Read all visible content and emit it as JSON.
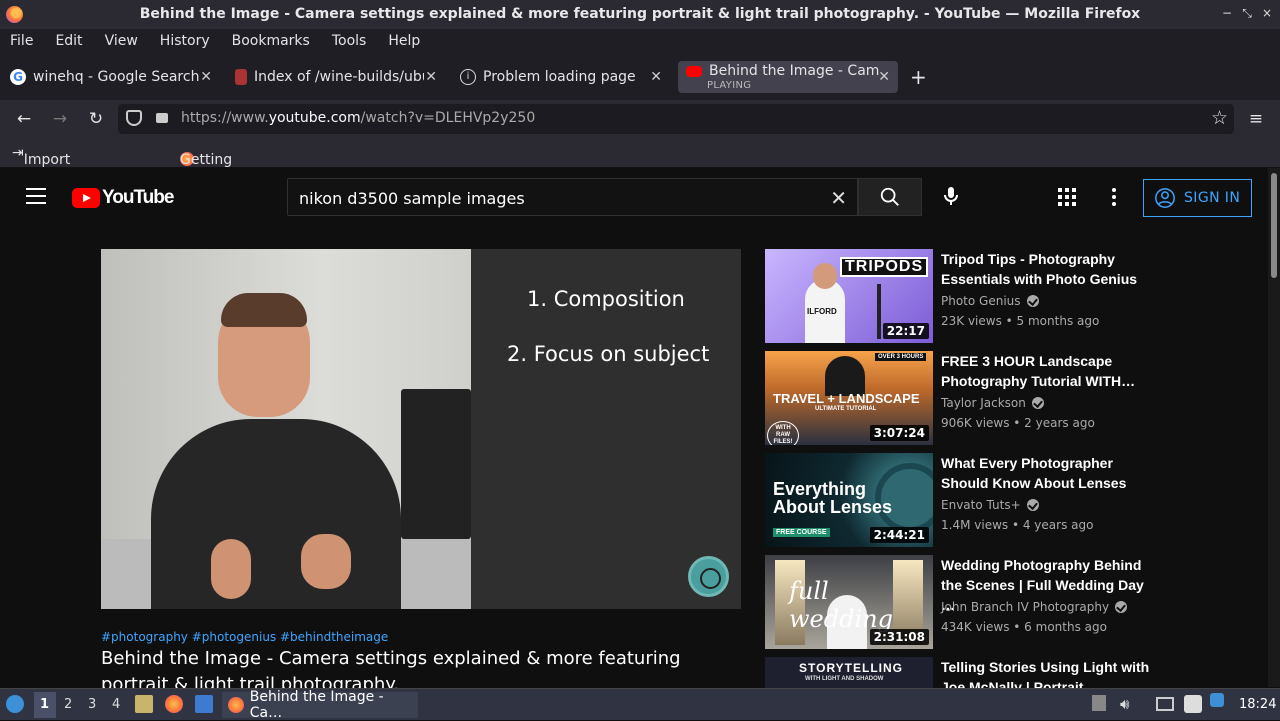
{
  "window": {
    "title": "Behind the Image - Camera settings explained & more featuring portrait & light trail photography. - YouTube — Mozilla Firefox",
    "minimize": "−",
    "maximize": "⤡",
    "close": "×"
  },
  "menu": [
    "File",
    "Edit",
    "View",
    "History",
    "Bookmarks",
    "Tools",
    "Help"
  ],
  "tabs": [
    {
      "label": "winehq - Google Search",
      "icon": "google-icon"
    },
    {
      "label": "Index of /wine-builds/ubu",
      "icon": "page-icon"
    },
    {
      "label": "Problem loading page",
      "icon": "info-icon"
    },
    {
      "label": "Behind the Image - Came",
      "sub": "PLAYING",
      "icon": "youtube-icon",
      "active": true
    }
  ],
  "new_tab": "+",
  "address": {
    "prefix": "https://www.",
    "domain": "youtube.com",
    "path": "/watch?v=DLEHVp2y250"
  },
  "bookmarks": [
    "Import bookmarks...",
    "Getting Started"
  ],
  "youtube": {
    "logo_text": "YouTube",
    "search_query": "nikon d3500 sample images",
    "sign_in": "SIGN IN"
  },
  "player": {
    "slide_lines": [
      "1. Composition",
      "2. Focus on subject"
    ]
  },
  "video": {
    "hashtags": "#photography #photogenius #behindtheimage",
    "title": "Behind the Image - Camera settings explained & more featuring portrait & light trail photography."
  },
  "recommendations": [
    {
      "title": "Tripod Tips - Photography Essentials with Photo Genius",
      "channel": "Photo Genius",
      "meta": "23K views • 5 months ago",
      "duration": "22:17",
      "thumb_text": "TRIPODS",
      "thumb_sub": "ILFORD"
    },
    {
      "title": "FREE 3 HOUR Landscape Photography Tutorial WITH…",
      "channel": "Taylor Jackson",
      "meta": "906K views • 2 years ago",
      "duration": "3:07:24",
      "thumb_text": "TRAVEL + LANDSCAPE",
      "thumb_sub": "ULTIMATE TUTORIAL",
      "thumb_tag": "OVER 3 HOURS",
      "thumb_badge": "WITH RAW FILES!"
    },
    {
      "title": "What Every Photographer Should Know About Lenses",
      "channel": "Envato Tuts+",
      "meta": "1.4M views • 4 years ago",
      "duration": "2:44:21",
      "thumb_text": "Everything About Lenses",
      "thumb_sub": "FREE COURSE"
    },
    {
      "title": "Wedding Photography Behind the Scenes | Full Wedding Day …",
      "channel": "John Branch IV Photography",
      "meta": "434K views • 6 months ago",
      "duration": "2:31:08",
      "thumb_text": "full wedding"
    },
    {
      "title": "Telling Stories Using Light with Joe McNally | Portrait…",
      "thumb_text": "STORYTELLING",
      "thumb_sub": "WITH LIGHT AND SHADOW"
    }
  ],
  "taskbar": {
    "workspaces": [
      "1",
      "2",
      "3",
      "4"
    ],
    "task_label": "Behind the Image - Ca…",
    "clock": "18:24"
  },
  "colors": {
    "accent": "#3ea6ff",
    "yt_red": "#ff0000",
    "background": "#0f0f0f"
  }
}
